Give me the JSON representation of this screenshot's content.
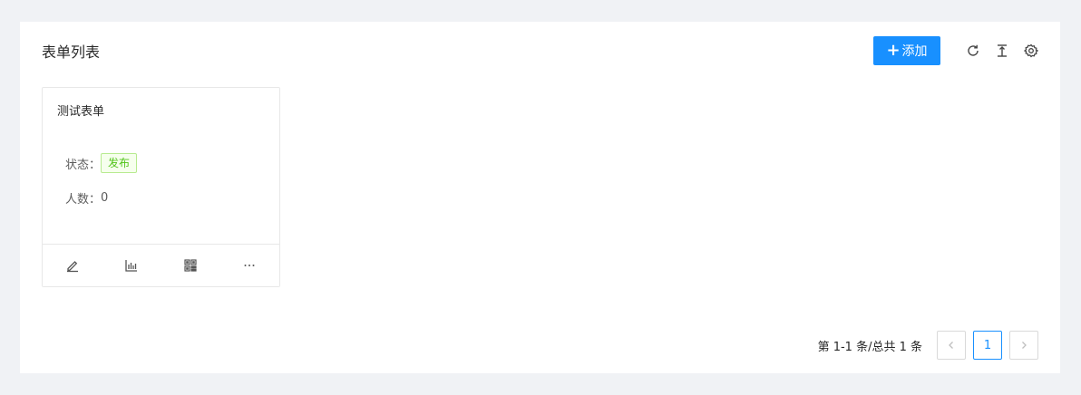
{
  "header": {
    "title": "表单列表",
    "add_label": "添加",
    "add_icon": "plus-icon",
    "tools": [
      "reload-icon",
      "vertical-align-top-icon",
      "setting-icon"
    ]
  },
  "colors": {
    "primary": "#1890ff",
    "success": "#52c41a",
    "background": "#f0f2f5"
  },
  "cards": [
    {
      "title": "测试表单",
      "status_label": "状态：",
      "status_value": "发布",
      "count_label": "人数：",
      "count_value": "0",
      "actions": [
        "edit-icon",
        "bar-chart-icon",
        "qrcode-icon",
        "ellipsis-icon"
      ]
    }
  ],
  "pagination": {
    "total_text": "第 1-1 条/总共 1 条",
    "current_page": "1",
    "prev_icon": "left-icon",
    "next_icon": "right-icon"
  }
}
